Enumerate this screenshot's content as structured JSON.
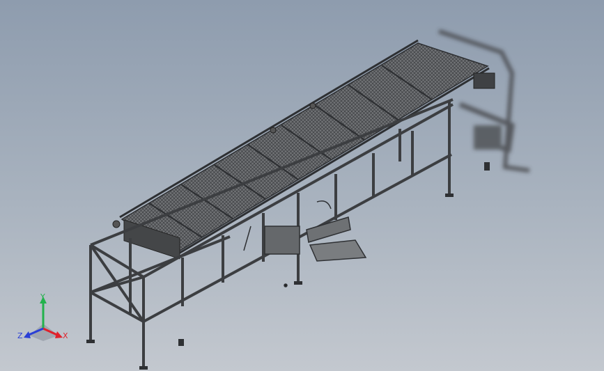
{
  "viewport": {
    "colors": {
      "frame": "#54565a",
      "frame_dark": "#2e3033",
      "belt": "#6b6d70",
      "belt_mesh": "#3a3c3f",
      "axis_x": "#e0212b",
      "axis_y": "#22b24c",
      "axis_z": "#2a3fd6"
    }
  },
  "triad": {
    "x_label": "X",
    "y_label": "Y",
    "z_label": "Z",
    "icons": [
      "x-axis-arrow-icon",
      "y-axis-arrow-icon",
      "z-axis-arrow-icon"
    ]
  }
}
